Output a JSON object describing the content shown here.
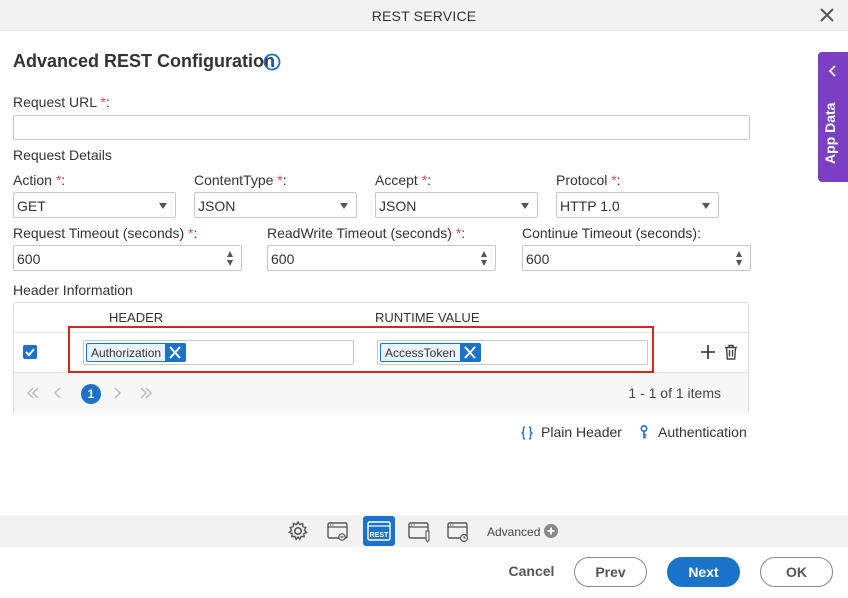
{
  "window": {
    "title": "REST SERVICE"
  },
  "heading": "Advanced REST Configuration",
  "request_url": {
    "label": "Request URL",
    "required_mark": "*",
    "suffix": ":",
    "value": ""
  },
  "request_details": {
    "title": "Request Details",
    "action": {
      "label": "Action",
      "value": "GET"
    },
    "content_type": {
      "label": "ContentType",
      "value": "JSON"
    },
    "accept": {
      "label": "Accept",
      "value": "JSON"
    },
    "protocol": {
      "label": "Protocol",
      "value": "HTTP 1.0"
    },
    "request_timeout": {
      "label": "Request Timeout (seconds)",
      "value": "600"
    },
    "readwrite_timeout": {
      "label": "ReadWrite Timeout (seconds)",
      "value": "600"
    },
    "continue_timeout": {
      "label": "Continue Timeout (seconds):",
      "value": "600"
    }
  },
  "header_info": {
    "title": "Header Information",
    "columns": {
      "header": "HEADER",
      "runtime": "RUNTIME VALUE"
    },
    "rows": [
      {
        "header": "Authorization",
        "runtime": "AccessToken",
        "checked": true
      }
    ],
    "pager": {
      "current_page": "1",
      "items_text": "1 - 1 of 1 items"
    }
  },
  "links": {
    "plain_header": "Plain Header",
    "authentication": "Authentication"
  },
  "side_panel": {
    "label": "App Data"
  },
  "toolbar": {
    "advanced_label": "Advanced",
    "active_icon_text": "REST"
  },
  "buttons": {
    "cancel": "Cancel",
    "prev": "Prev",
    "next": "Next",
    "ok": "OK"
  },
  "colors": {
    "accent": "#1a73c9",
    "side_tab": "#7b3fc4",
    "highlight": "#d0281e",
    "required": "#d9534f"
  }
}
